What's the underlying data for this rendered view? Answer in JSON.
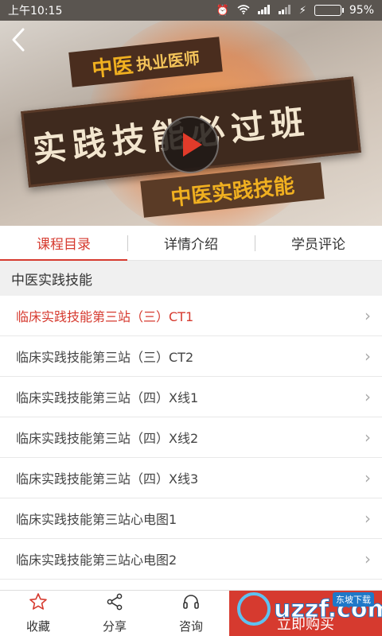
{
  "status_bar": {
    "time": "上午10:15",
    "battery": "95%",
    "battery_level": 0.95
  },
  "banner": {
    "tag_top_main": "中医",
    "tag_top_sub": "执业医师",
    "board_title": "实践技能必过班",
    "tag_bottom": "中医实践技能"
  },
  "tabs": [
    {
      "label": "课程目录",
      "active": true
    },
    {
      "label": "详情介绍",
      "active": false
    },
    {
      "label": "学员评论",
      "active": false
    }
  ],
  "section_title": "中医实践技能",
  "lessons": [
    {
      "title": "临床实践技能第三站（三）CT1",
      "current": true
    },
    {
      "title": "临床实践技能第三站（三）CT2",
      "current": false
    },
    {
      "title": "临床实践技能第三站（四）X线1",
      "current": false
    },
    {
      "title": "临床实践技能第三站（四）X线2",
      "current": false
    },
    {
      "title": "临床实践技能第三站（四）X线3",
      "current": false
    },
    {
      "title": "临床实践技能第三站心电图1",
      "current": false
    },
    {
      "title": "临床实践技能第三站心电图2",
      "current": false
    }
  ],
  "bottom_bar": {
    "favorite": "收藏",
    "share": "分享",
    "consult": "咨询",
    "buy": "立即购买",
    "watermark": "uzzf.com",
    "watermark_sub": "东坡下载"
  },
  "colors": {
    "accent": "#d63a2f"
  }
}
